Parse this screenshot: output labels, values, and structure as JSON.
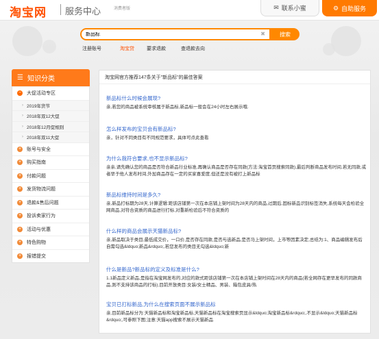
{
  "header": {
    "logo": "淘宝网",
    "subtitle": "服务中心",
    "tagline": "消费者版",
    "contact_label": "联系小蜜",
    "self_service_label": "自助服务"
  },
  "search": {
    "value": "新品标",
    "button": "搜索"
  },
  "quick_links": [
    "注册账号",
    "淘宝贷",
    "要求退款",
    "查退款去向"
  ],
  "sidebar": {
    "title": "知识分类",
    "expanded": "大促活动专区",
    "sub_items": [
      "2019年货节",
      "2018年双12大促",
      "2018年12月促规则",
      "2018年双11大促"
    ],
    "items": [
      "账号与安全",
      "购买指南",
      "付款问题",
      "发货物流问题",
      "退款&售后问题",
      "投诉卖家行为",
      "活动与优惠",
      "特色购物",
      "报错提交"
    ]
  },
  "main": {
    "heading": "淘宝网官方推荐147条关于\"新品标\"的最佳答案",
    "questions": [
      {
        "title": "新品标什么时候会展现?",
        "body": "亲,若您的商品被系统审核属于新品标,新品标一般会在24小时左右展示哦."
      },
      {
        "title": "怎么样发布的宝贝会有新品标?",
        "body": "亲，针对不同类目有不同规范要求，具体可点此查看"
      },
      {
        "title": "为什么我符合要求,也不显示新品标?",
        "body": "亲亲,请先确认您的商品是否符合新品行业标准,再确认商品是否存在同款(方法:淘宝首页搜索同款),最后判断商品发布时间,若无同款,或者早于他人发布时间,外加商品存在一定的买家喜爱度,但还是没有被打上新品标"
      },
      {
        "title": "新品标维持时间是多久?",
        "body": "亲,新品打标期为28天,计算逻辑:距该店铺第一次在本店铺上架时间为28天内的商品,过期后,固标新品识别标签消失,系统每天会检验全网商品,对符合资质的商品进行打标,对重新检验后不符合资质的"
      },
      {
        "title": "什么样的商品会展示天猫新品标?",
        "body": "亲,新品取决于类目,最低成交价，一口价,是否存在同款,是否与选新品,是否马上架时间，上市等因素决定,总结为:1、商品编辑发布后自需勾选&ldquo;新品&rdquo;,若您发布的类目无勾选&ldquo;新"
      },
      {
        "title": "什么是新品?新品标的定义及标准是什么?",
        "body": "1.1新品定义新品,是指在淘宝网发布的,对应的款式距该店铺第一次在本店铺上架时间在28天内的商品(若全网存在更早发布的同款商品,则不支持该商品的打标),目前开放类目:女装/女士精品、男装、箱包皮具/热"
      },
      {
        "title": "宝贝已打标新品,为什么在搜索页面不展示新品标",
        "body": "亲,目前新品标分为:天猫新品标和淘宝新品标,天猫新品标在淘宝搜索页显示&ldquo;淘宝新品标&rdquo;,不显示&ldquo;天猫新品标&rdquo;,可参照下图;注意:天猫app搜索不展示天猫新品"
      }
    ]
  },
  "colors": {
    "brand_orange": "#ff5000",
    "accent_orange": "#ff8800",
    "link_blue": "#3366cc",
    "highlight_red": "#e4393c"
  }
}
